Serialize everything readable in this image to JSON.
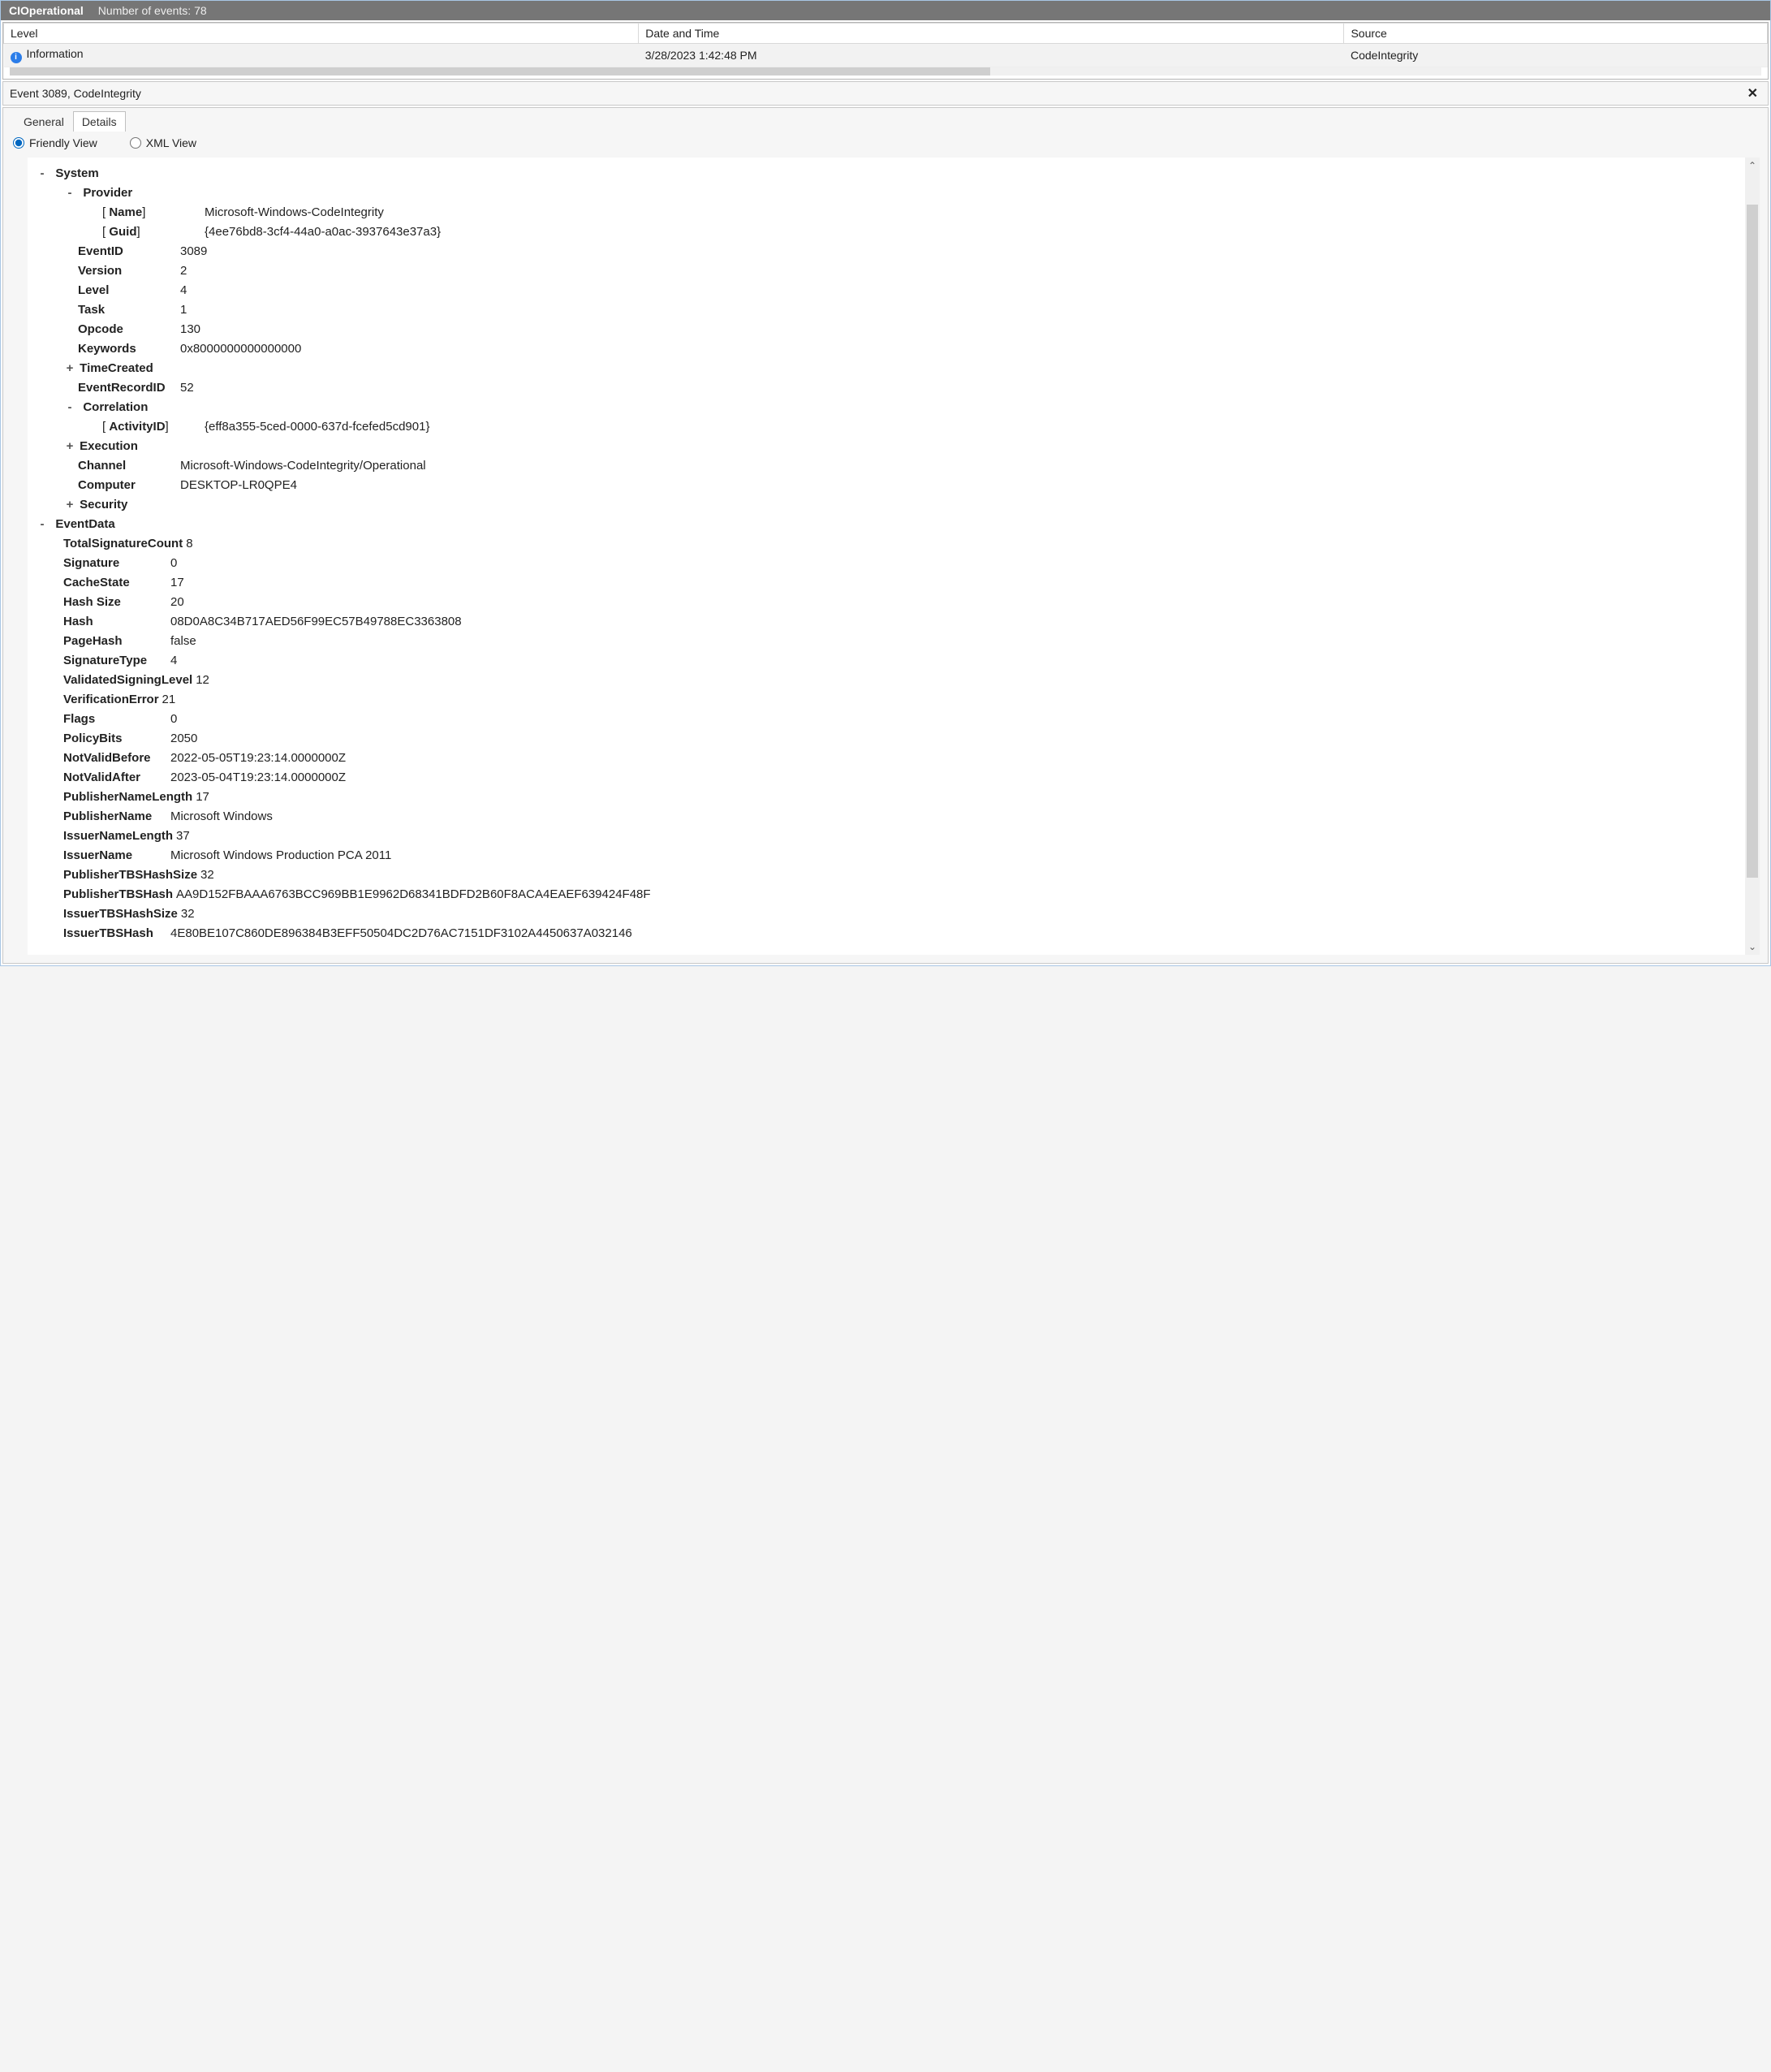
{
  "titlebar": {
    "title": "CIOperational",
    "subtitle": "Number of events: 78"
  },
  "columns": {
    "level": "Level",
    "datetime": "Date and Time",
    "source": "Source"
  },
  "row": {
    "level": "Information",
    "datetime": "3/28/2023 1:42:48 PM",
    "source": "CodeIntegrity"
  },
  "detail": {
    "header": "Event 3089, CodeIntegrity"
  },
  "tabs": {
    "general": "General",
    "details": "Details"
  },
  "views": {
    "friendly": "Friendly View",
    "xml": "XML View"
  },
  "nodes": {
    "system": "System",
    "provider": "Provider",
    "timecreated": "TimeCreated",
    "correlation": "Correlation",
    "execution": "Execution",
    "security": "Security",
    "eventdata": "EventData"
  },
  "provider": {
    "name_k": "Name",
    "name_v": "Microsoft-Windows-CodeIntegrity",
    "guid_k": "Guid",
    "guid_v": "{4ee76bd8-3cf4-44a0-a0ac-3937643e37a3}"
  },
  "system": {
    "eventid_k": "EventID",
    "eventid_v": "3089",
    "version_k": "Version",
    "version_v": "2",
    "level_k": "Level",
    "level_v": "4",
    "task_k": "Task",
    "task_v": "1",
    "opcode_k": "Opcode",
    "opcode_v": "130",
    "keywords_k": "Keywords",
    "keywords_v": "0x8000000000000000",
    "eventrecordid_k": "EventRecordID",
    "eventrecordid_v": "52",
    "activityid_k": "ActivityID",
    "activityid_v": "{eff8a355-5ced-0000-637d-fcefed5cd901}",
    "channel_k": "Channel",
    "channel_v": "Microsoft-Windows-CodeIntegrity/Operational",
    "computer_k": "Computer",
    "computer_v": "DESKTOP-LR0QPE4"
  },
  "ed": {
    "totalsigcount_k": "TotalSignatureCount",
    "totalsigcount_v": "8",
    "signature_k": "Signature",
    "signature_v": "0",
    "cachestate_k": "CacheState",
    "cachestate_v": "17",
    "hashsize_k": "Hash Size",
    "hashsize_v": "20",
    "hash_k": "Hash",
    "hash_v": "08D0A8C34B717AED56F99EC57B49788EC3363808",
    "pagehash_k": "PageHash",
    "pagehash_v": "false",
    "sigtype_k": "SignatureType",
    "sigtype_v": "4",
    "vsl_k": "ValidatedSigningLevel",
    "vsl_v": "12",
    "verr_k": "VerificationError",
    "verr_v": "21",
    "flags_k": "Flags",
    "flags_v": "0",
    "policybits_k": "PolicyBits",
    "policybits_v": "2050",
    "nvb_k": "NotValidBefore",
    "nvb_v": "2022-05-05T19:23:14.0000000Z",
    "nva_k": "NotValidAfter",
    "nva_v": "2023-05-04T19:23:14.0000000Z",
    "pnl_k": "PublisherNameLength",
    "pnl_v": "17",
    "pn_k": "PublisherName",
    "pn_v": "Microsoft Windows",
    "inl_k": "IssuerNameLength",
    "inl_v": "37",
    "in_k": "IssuerName",
    "in_v": "Microsoft Windows Production PCA 2011",
    "pths_k": "PublisherTBSHashSize",
    "pths_v": "32",
    "pth_k": "PublisherTBSHash",
    "pth_v": "AA9D152FBAAA6763BCC969BB1E9962D68341BDFD2B60F8ACA4EAEF639424F48F",
    "iths_k": "IssuerTBSHashSize",
    "iths_v": "32",
    "ith_k": "IssuerTBSHash",
    "ith_v": "4E80BE107C860DE896384B3EFF50504DC2D76AC7151DF3102A4450637A032146"
  }
}
